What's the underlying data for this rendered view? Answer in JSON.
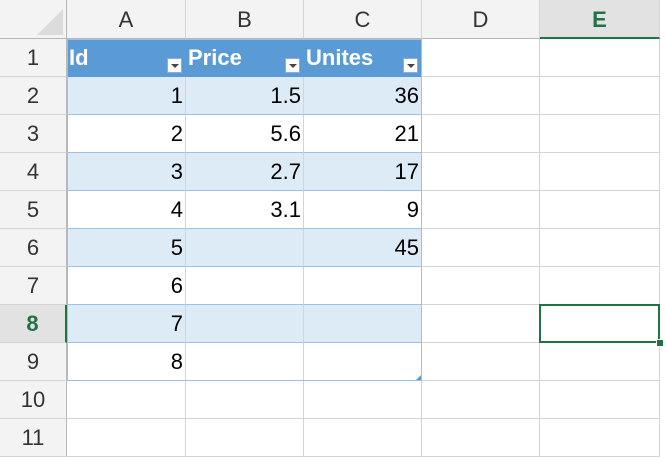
{
  "columns": [
    "A",
    "B",
    "C",
    "D",
    "E"
  ],
  "rows": [
    "1",
    "2",
    "3",
    "4",
    "5",
    "6",
    "7",
    "8",
    "9",
    "10",
    "11"
  ],
  "active_cell": {
    "column": "E",
    "row": "8"
  },
  "table": {
    "headers": [
      "Id",
      "Price",
      "Unites"
    ],
    "rows": [
      [
        "1",
        "1.5",
        "36"
      ],
      [
        "2",
        "5.6",
        "21"
      ],
      [
        "3",
        "2.7",
        "17"
      ],
      [
        "4",
        "3.1",
        "9"
      ],
      [
        "5",
        "",
        "45"
      ],
      [
        "6",
        "",
        ""
      ],
      [
        "7",
        "",
        ""
      ],
      [
        "8",
        "",
        ""
      ]
    ]
  },
  "colors": {
    "table_header": "#5b9bd5",
    "table_band": "#ddebf7",
    "selection": "#217346"
  }
}
